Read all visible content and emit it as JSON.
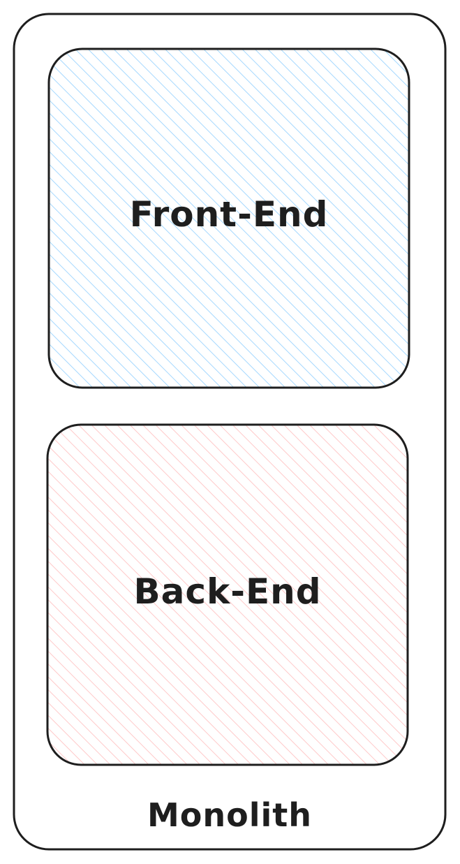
{
  "diagram": {
    "container": {
      "label": "Monolith",
      "stroke": "#1e1e1e"
    },
    "blocks": [
      {
        "id": "front-end",
        "label": "Front-End",
        "hatch_color": "#a5d8ff",
        "stroke": "#1e1e1e"
      },
      {
        "id": "back-end",
        "label": "Back-End",
        "hatch_color": "#ffc9c9",
        "stroke": "#1e1e1e"
      }
    ]
  }
}
